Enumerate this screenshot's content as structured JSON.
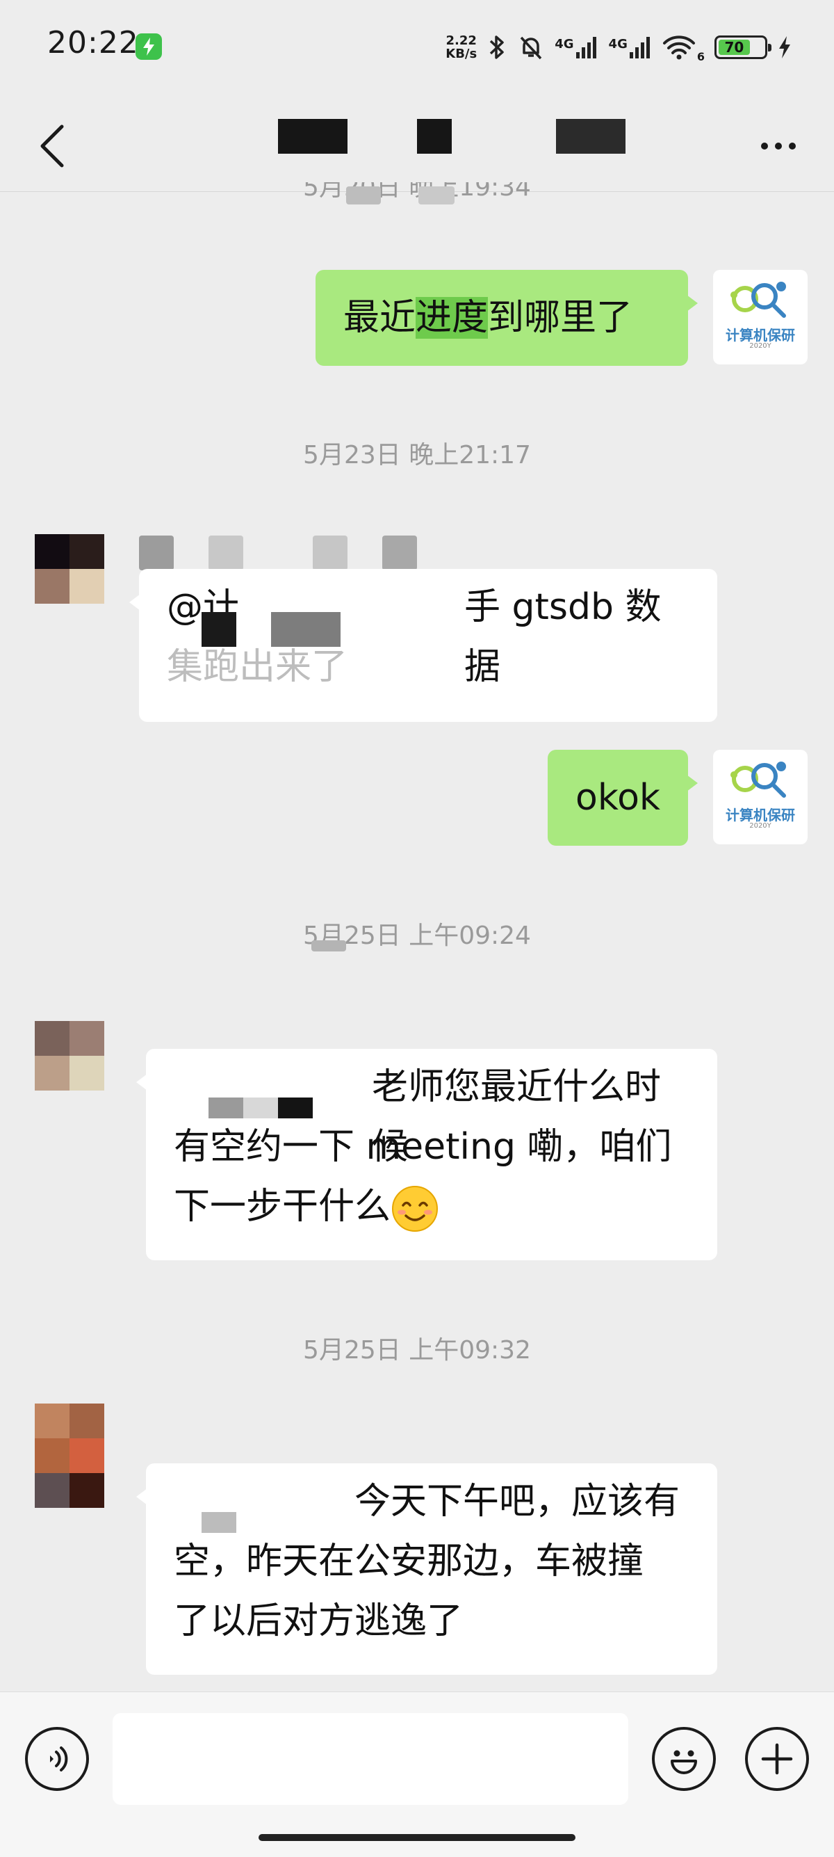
{
  "status_bar": {
    "time": "20:22",
    "net_speed_value": "2.22",
    "net_speed_unit": "KB/s",
    "net_type_1": "4G",
    "net_type_2": "4G",
    "wifi_band": "6",
    "battery_level": "70",
    "icons": [
      "charging-icon",
      "bluetooth-icon",
      "mute-bell-icon",
      "signal-icon",
      "wifi-icon",
      "battery-icon",
      "charging-bolt-icon"
    ]
  },
  "header": {
    "back_icon": "chevron-left-icon",
    "more_icon": "ellipsis-icon",
    "title_redacted": true
  },
  "messages": {
    "ts_top": "5月20日 晚上19:34",
    "msg1": {
      "side": "mine",
      "text_a": "最近",
      "text_highlight": "进度",
      "text_b": "到哪里了"
    },
    "ts_2": "5月23日 晚上21:17",
    "msg2": {
      "side": "other",
      "line1_prefix": "@计",
      "line1_text": "手 gtsdb 数据",
      "line2_text": "集跑出来了"
    },
    "msg3": {
      "side": "mine",
      "text": "okok"
    },
    "ts_3": "5月25日 上午09:24",
    "msg4": {
      "side": "other",
      "line1_text": "老师您最近什么时候",
      "line2_text": "有空约一下 meeting 嘞，咱们",
      "line3_text": "下一步干什么",
      "emoji": "smiling-face-emoji"
    },
    "ts_4": "5月25日 上午09:32",
    "msg5": {
      "side": "other",
      "line1_text": "今天下午吧，应该有",
      "line2_text": "空，昨天在公安那边，车被撞",
      "line3_text": "了以后对方逃逸了"
    }
  },
  "my_avatar": {
    "caption": "计算机保研",
    "sub": "2020Y"
  },
  "input_bar": {
    "voice_icon": "voice-icon",
    "emoji_icon": "emoji-icon",
    "plus_icon": "plus-icon",
    "placeholder": ""
  },
  "colors": {
    "background": "#ededed",
    "bubble_mine": "#a9e97f",
    "bubble_other": "#ffffff",
    "highlight": "#6ecb4c",
    "timestamp": "#9a9a9a"
  }
}
